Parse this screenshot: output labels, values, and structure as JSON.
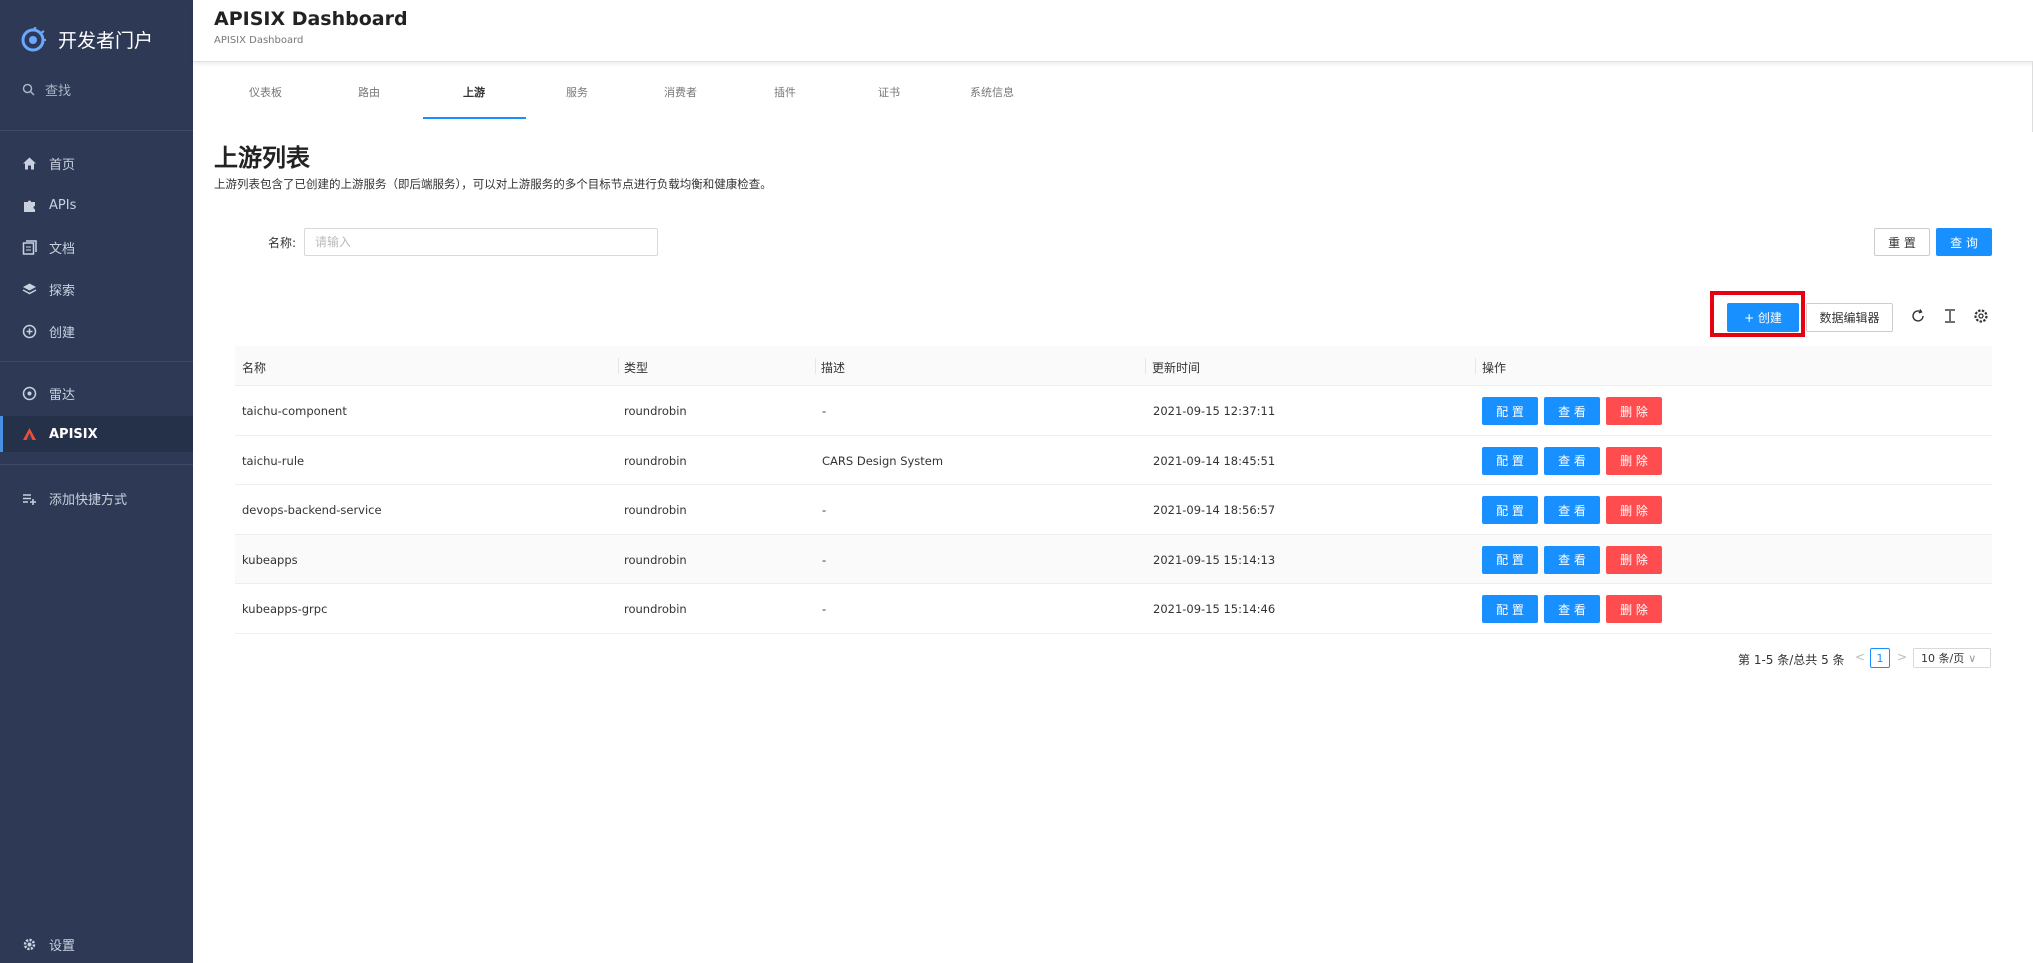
{
  "sidebar": {
    "brand": "开发者门户",
    "search_label": "查找",
    "items": [
      {
        "label": "首页"
      },
      {
        "label": "APIs"
      },
      {
        "label": "文档"
      },
      {
        "label": "探索"
      },
      {
        "label": "创建"
      },
      {
        "label": "雷达"
      },
      {
        "label": "APISIX"
      },
      {
        "label": "添加快捷方式"
      }
    ],
    "settings_label": "设置"
  },
  "header": {
    "title": "APISIX Dashboard",
    "subtitle": "APISIX Dashboard"
  },
  "tabs": [
    {
      "label": "仪表板"
    },
    {
      "label": "路由"
    },
    {
      "label": "上游"
    },
    {
      "label": "服务"
    },
    {
      "label": "消费者"
    },
    {
      "label": "插件"
    },
    {
      "label": "证书"
    },
    {
      "label": "系统信息"
    }
  ],
  "page": {
    "title": "上游列表",
    "description": "上游列表包含了已创建的上游服务（即后端服务），可以对上游服务的多个目标节点进行负载均衡和健康检查。"
  },
  "search": {
    "label": "名称:",
    "placeholder": "请输入",
    "reset_label": "重 置",
    "query_label": "查 询"
  },
  "toolbar": {
    "create_label": "+ 创建",
    "data_editor_label": "数据编辑器"
  },
  "table": {
    "columns": [
      "名称",
      "类型",
      "描述",
      "更新时间",
      "操作"
    ],
    "rows": [
      {
        "name": "taichu-component",
        "type": "roundrobin",
        "desc": "-",
        "updated": "2021-09-15 12:37:11"
      },
      {
        "name": "taichu-rule",
        "type": "roundrobin",
        "desc": "CARS Design System",
        "updated": "2021-09-14 18:45:51"
      },
      {
        "name": "devops-backend-service",
        "type": "roundrobin",
        "desc": "-",
        "updated": "2021-09-14 18:56:57"
      },
      {
        "name": "kubeapps",
        "type": "roundrobin",
        "desc": "-",
        "updated": "2021-09-15 15:14:13"
      },
      {
        "name": "kubeapps-grpc",
        "type": "roundrobin",
        "desc": "-",
        "updated": "2021-09-15 15:14:46"
      }
    ],
    "actions": {
      "configure": "配 置",
      "view": "查 看",
      "delete": "删 除"
    }
  },
  "pagination": {
    "summary": "第 1-5 条/总共 5 条",
    "prev": "<",
    "next": ">",
    "current_page": "1",
    "page_size": "10 条/页",
    "page_size_arrow": "∨"
  },
  "colors": {
    "sidebar_bg": "#2e3a55",
    "primary": "#1890ff",
    "danger": "#ff4d4f",
    "highlight": "#e60012"
  }
}
